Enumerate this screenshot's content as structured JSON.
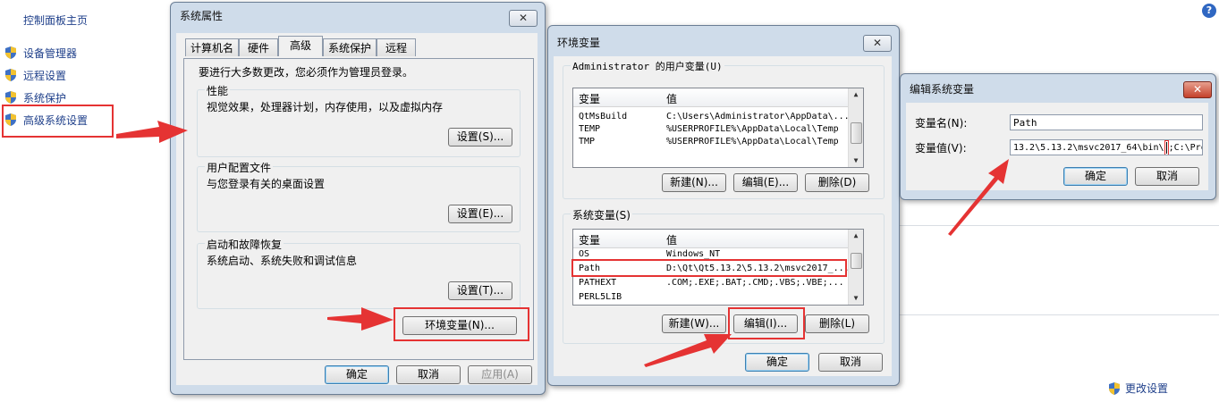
{
  "control_panel": {
    "title": "控制面板主页",
    "items": [
      {
        "label": "设备管理器"
      },
      {
        "label": "远程设置"
      },
      {
        "label": "系统保护"
      },
      {
        "label": "高级系统设置"
      }
    ],
    "change_settings": "更改设置"
  },
  "sysprop": {
    "title": "系统属性",
    "tabs": [
      "计算机名",
      "硬件",
      "高级",
      "系统保护",
      "远程"
    ],
    "admin_note": "要进行大多数更改，您必须作为管理员登录。",
    "performance": {
      "label": "性能",
      "desc": "视觉效果，处理器计划，内存使用，以及虚拟内存",
      "button": "设置(S)..."
    },
    "user_profiles": {
      "label": "用户配置文件",
      "desc": "与您登录有关的桌面设置",
      "button": "设置(E)..."
    },
    "startup": {
      "label": "启动和故障恢复",
      "desc": "系统启动、系统失败和调试信息",
      "button": "设置(T)..."
    },
    "env_button": "环境变量(N)...",
    "ok": "确定",
    "cancel": "取消",
    "apply": "应用(A)"
  },
  "envvars": {
    "title": "环境变量",
    "user_section": "Administrator 的用户变量(U)",
    "col_var": "变量",
    "col_val": "值",
    "user_rows": [
      {
        "name": "QtMsBuild",
        "value": "C:\\Users\\Administrator\\AppData\\..."
      },
      {
        "name": "TEMP",
        "value": "%USERPROFILE%\\AppData\\Local\\Temp"
      },
      {
        "name": "TMP",
        "value": "%USERPROFILE%\\AppData\\Local\\Temp"
      }
    ],
    "user_buttons": {
      "new": "新建(N)...",
      "edit": "编辑(E)...",
      "delete": "删除(D)"
    },
    "sys_section": "系统变量(S)",
    "sys_rows": [
      {
        "name": "OS",
        "value": "Windows_NT"
      },
      {
        "name": "Path",
        "value": "D:\\Qt\\Qt5.13.2\\5.13.2\\msvc2017_..."
      },
      {
        "name": "PATHEXT",
        "value": ".COM;.EXE;.BAT;.CMD;.VBS;.VBE;..."
      },
      {
        "name": "PERL5LIB",
        "value": ""
      }
    ],
    "sys_buttons": {
      "new": "新建(W)...",
      "edit": "编辑(I)...",
      "delete": "删除(L)"
    },
    "ok": "确定",
    "cancel": "取消"
  },
  "editvar": {
    "title": "编辑系统变量",
    "name_label": "变量名(N):",
    "name_value": "Path",
    "value_label": "变量值(V):",
    "value_before": "13.2\\5.13.2\\msvc2017_64\\bin\\",
    "value_after": ";C:\\Pro",
    "ok": "确定",
    "cancel": "取消"
  },
  "colors": {
    "highlight": "#e53333",
    "link": "#1e3f8a"
  }
}
